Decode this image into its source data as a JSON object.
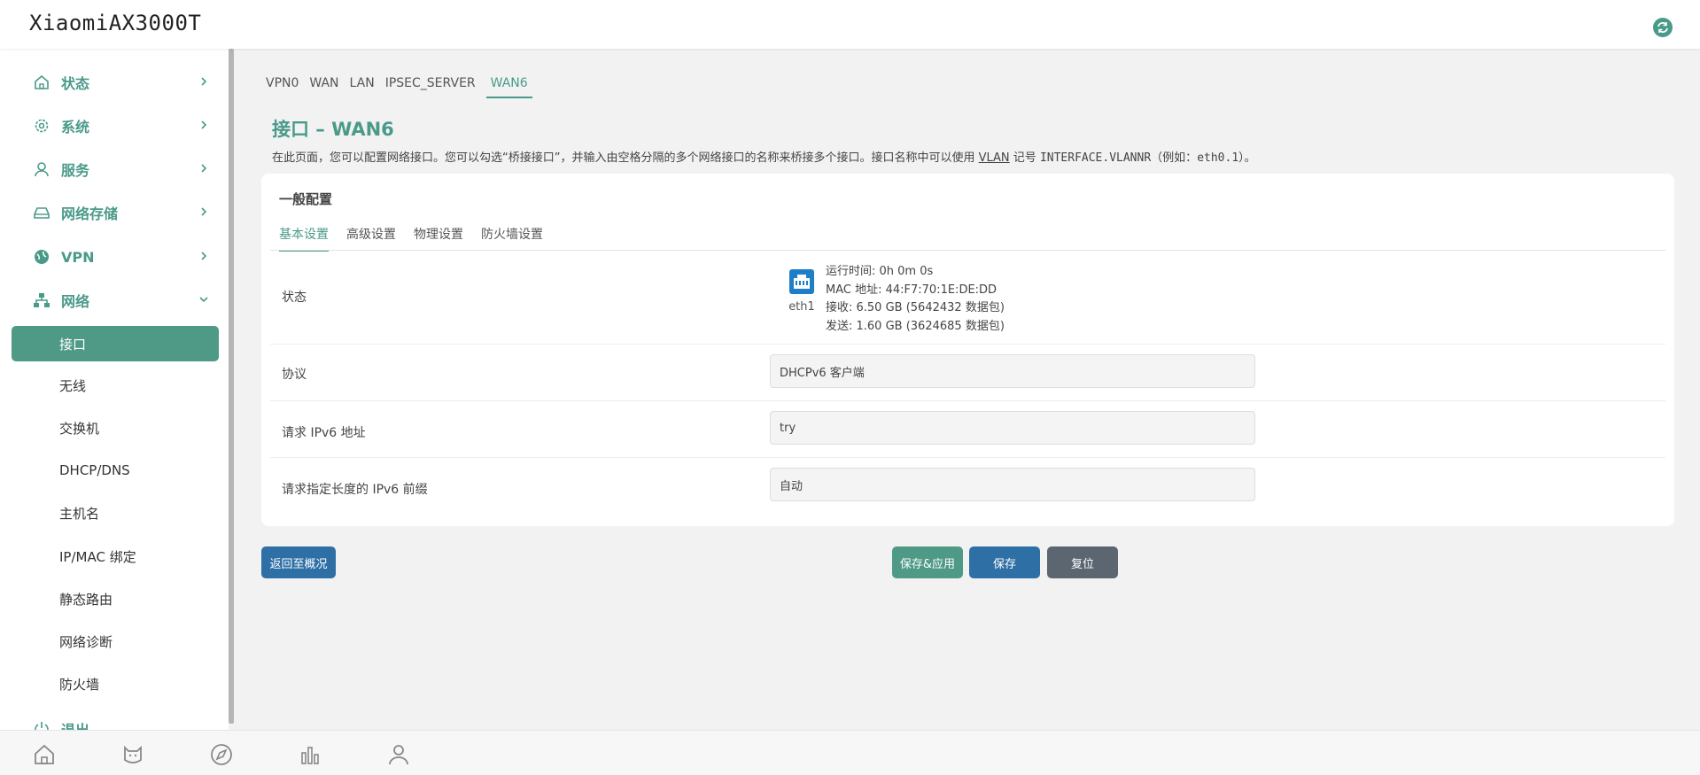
{
  "header": {
    "brand": "XiaomiAX3000T"
  },
  "sidebar": {
    "menu": [
      {
        "label": "状态",
        "icon": "home-icon"
      },
      {
        "label": "系统",
        "icon": "gear-icon"
      },
      {
        "label": "服务",
        "icon": "user-icon"
      },
      {
        "label": "网络存储",
        "icon": "storage-icon"
      },
      {
        "label": "VPN",
        "icon": "globe-icon"
      },
      {
        "label": "网络",
        "icon": "network-icon"
      }
    ],
    "submenu": [
      "接口",
      "无线",
      "交换机",
      "DHCP/DNS",
      "主机名",
      "IP/MAC 绑定",
      "静态路由",
      "网络诊断",
      "防火墙"
    ],
    "logout": "退出"
  },
  "top_tabs": [
    "VPN0",
    "WAN",
    "LAN",
    "IPSEC_SERVER",
    "WAN6"
  ],
  "page": {
    "title": "接口 – WAN6",
    "desc_1": "在此页面，您可以配置网络接口。您可以勾选“桥接接口”，并输入由空格分隔的多个网络接口的名称来桥接多个接口。接口名称中可以使用 ",
    "desc_link": "VLAN",
    "desc_2": " 记号 ",
    "desc_mono_1": "INTERFACE.VLANNR",
    "desc_3": "（例如：",
    "desc_mono_2": "eth0.1",
    "desc_4": "）。"
  },
  "section": {
    "title": "一般配置",
    "tabs": [
      "基本设置",
      "高级设置",
      "物理设置",
      "防火墙设置"
    ]
  },
  "status": {
    "label": "状态",
    "device": "eth1",
    "uptime": "运行时间: 0h 0m 0s",
    "mac": "MAC 地址: 44:F7:70:1E:DE:DD",
    "rx": "接收: 6.50 GB (5642432 数据包)",
    "tx": "发送: 1.60 GB (3624685 数据包)"
  },
  "fields": [
    {
      "label": "协议",
      "value": "DHCPv6 客户端"
    },
    {
      "label": "请求 IPv6 地址",
      "value": "try"
    },
    {
      "label": "请求指定长度的 IPv6 前缀",
      "value": "自动"
    }
  ],
  "buttons": {
    "back": "返回至概况",
    "save_apply": "保存&应用",
    "save": "保存",
    "reset": "复位"
  },
  "colors": {
    "accent": "#4a9a8a",
    "active_item": "#4e9a86",
    "primary_button": "#2e6fa6",
    "reset_button": "#5b6670"
  }
}
